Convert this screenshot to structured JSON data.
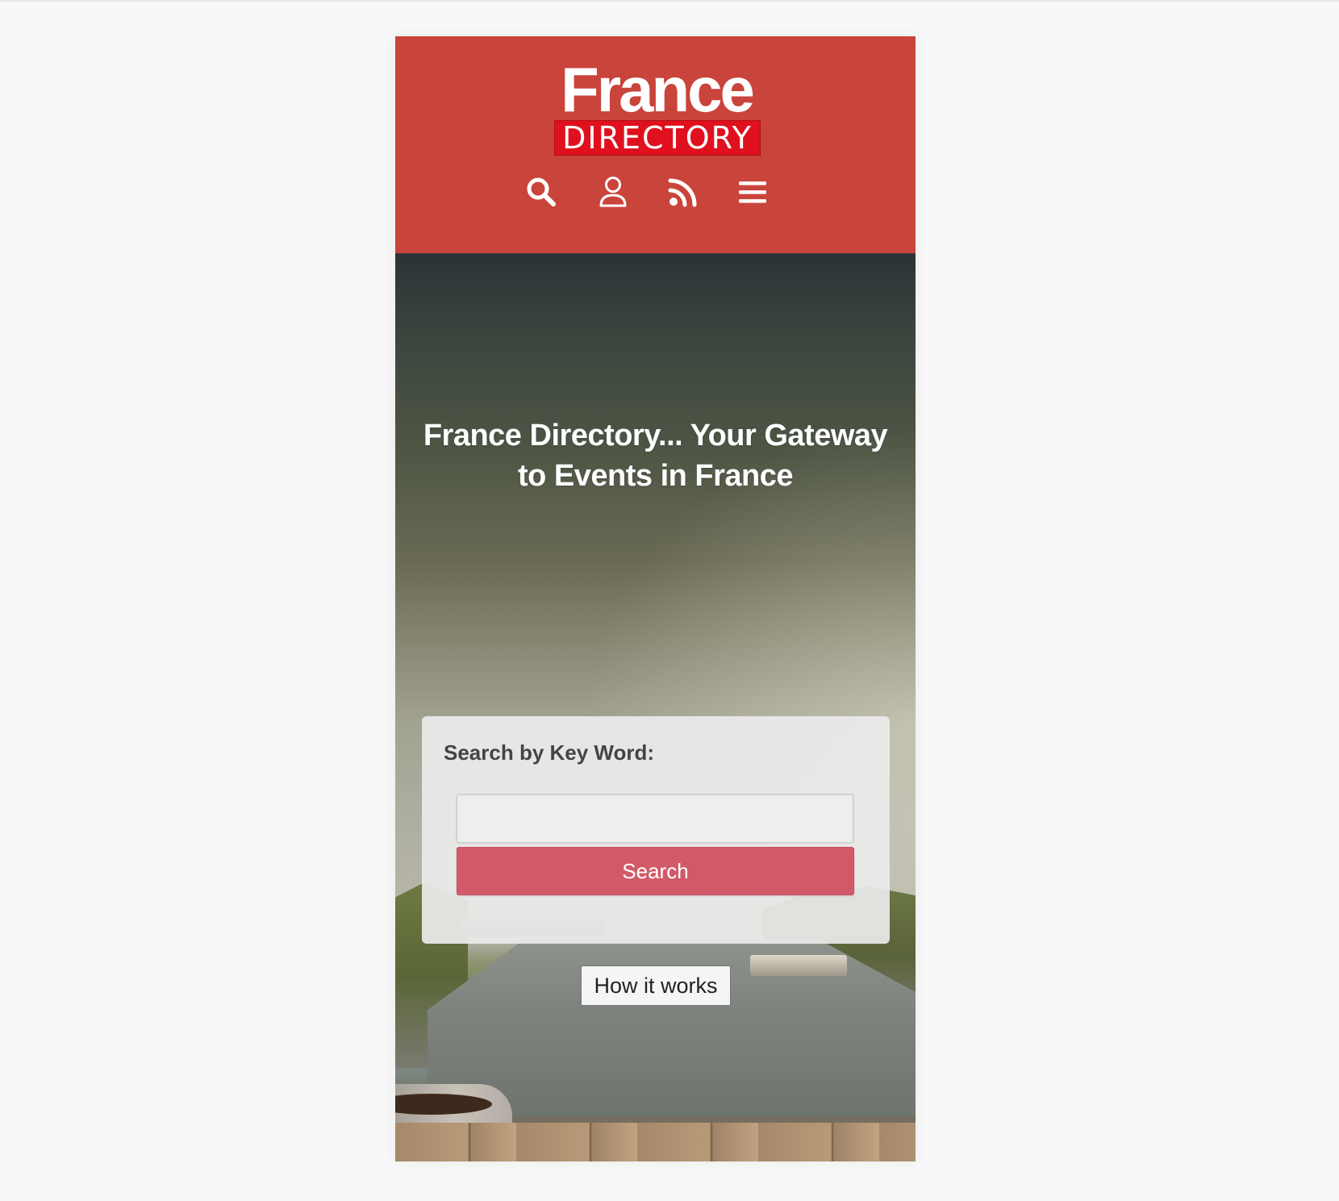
{
  "logo": {
    "line1": "France",
    "line2": "DIRECTORY"
  },
  "nav": {
    "icons": [
      "search-icon",
      "user-icon",
      "rss-icon",
      "menu-icon"
    ]
  },
  "hero": {
    "title": "France Directory... Your Gateway to Events in France"
  },
  "search": {
    "label": "Search by Key Word:",
    "input_value": "",
    "placeholder": "",
    "button_label": "Search"
  },
  "how_it_works": {
    "label": "How it works"
  },
  "colors": {
    "header": "#c9443b",
    "logo_band": "#e0101e",
    "search_button": "#d25a68"
  }
}
